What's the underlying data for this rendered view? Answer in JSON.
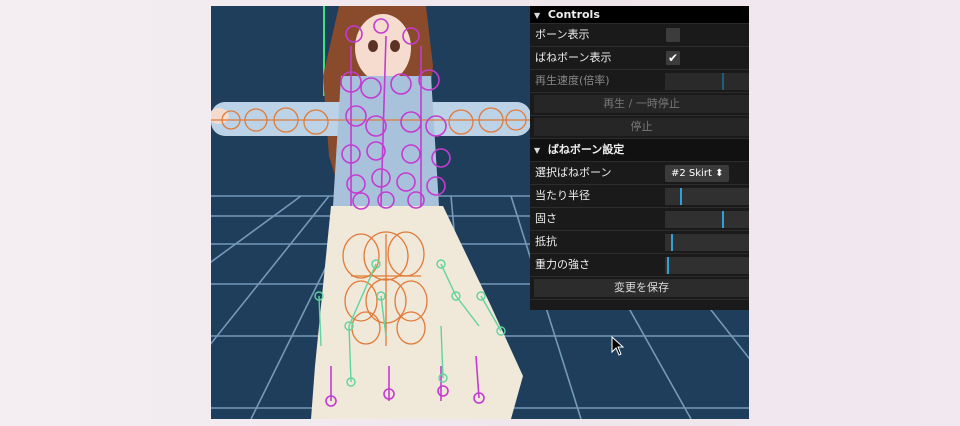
{
  "controls": {
    "title": "Controls",
    "show_bones_label": "ボーン表示",
    "show_bones_checked": false,
    "show_spring_bones_label": "ばねボーン表示",
    "show_spring_bones_checked": true,
    "show_spring_bones_mark": "✔",
    "playback_speed_label": "再生速度(倍率)",
    "playback_speed_fraction": 0.68,
    "play_pause_label": "再生 / 一時停止",
    "stop_label": "停止"
  },
  "spring_settings": {
    "title": "ばねボーン設定",
    "selected_label": "選択ばねボーン",
    "selected_value": "#2 Skirt",
    "select_arrow": "⬍",
    "hit_radius_label": "当たり半径",
    "hit_radius_fraction": 0.18,
    "stiffness_label": "固さ",
    "stiffness_fraction": 0.68,
    "drag_label": "抵抗",
    "drag_fraction": 0.07,
    "gravity_label": "重力の強さ",
    "gravity_fraction": 0.02,
    "save_label": "変更を保存"
  },
  "colors": {
    "viewport_bg": "#1f3e5c",
    "grid": "#7fa3c3",
    "bone_orange": "#e07b39",
    "bone_magenta": "#c43bd1",
    "spring_green": "#5fd4a0",
    "slider_fill": "#2fa1d6"
  },
  "icons": {
    "folder_arrow": "triangle-down-icon",
    "cursor": "mouse-pointer-icon"
  }
}
